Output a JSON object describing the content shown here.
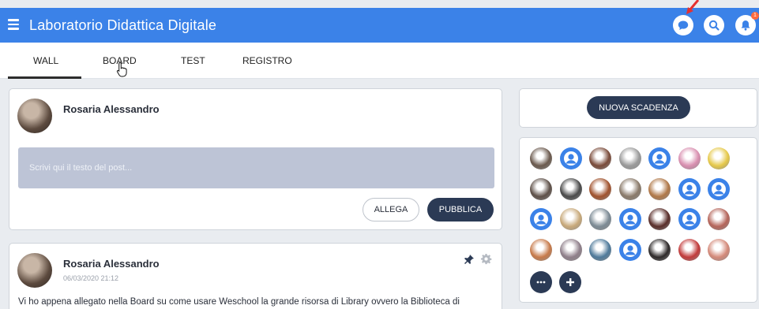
{
  "header": {
    "title": "Laboratorio Didattica Digitale",
    "notification_count": "1",
    "accent_color": "#3b82e8"
  },
  "tabs": [
    {
      "label": "WALL",
      "active": true
    },
    {
      "label": "BOARD",
      "active": false
    },
    {
      "label": "TEST",
      "active": false
    },
    {
      "label": "REGISTRO",
      "active": false
    }
  ],
  "composer": {
    "author": "Rosaria Alessandro",
    "placeholder": "Scrivi qui il testo del post...",
    "attach_label": "ALLEGA",
    "publish_label": "PUBBLICA"
  },
  "post": {
    "author": "Rosaria Alessandro",
    "date": "06/03/2020 21:12",
    "text": "Vi ho appena allegato nella Board su come usare Weschool la grande risorsa di Library ovvero la Biblioteca di"
  },
  "sidebar": {
    "new_deadline_label": "NUOVA SCADENZA",
    "members": [
      {
        "kind": "photo",
        "color": "#6b5a4e"
      },
      {
        "kind": "default",
        "color": "#3b82e8"
      },
      {
        "kind": "photo",
        "color": "#7a4b3a"
      },
      {
        "kind": "photo",
        "color": "#9a9a9a"
      },
      {
        "kind": "default",
        "color": "#3b82e8"
      },
      {
        "kind": "photo",
        "color": "#d98fb0"
      },
      {
        "kind": "photo",
        "color": "#e6c94a"
      },
      {
        "kind": "photo",
        "color": "#5e5048"
      },
      {
        "kind": "photo",
        "color": "#4a4a4a"
      },
      {
        "kind": "photo",
        "color": "#a0522d"
      },
      {
        "kind": "photo",
        "color": "#8a7a6a"
      },
      {
        "kind": "photo",
        "color": "#b07848"
      },
      {
        "kind": "default",
        "color": "#3b82e8"
      },
      {
        "kind": "default",
        "color": "#3b82e8"
      },
      {
        "kind": "default",
        "color": "#3b82e8"
      },
      {
        "kind": "photo",
        "color": "#c8a97a"
      },
      {
        "kind": "photo",
        "color": "#7c8a94"
      },
      {
        "kind": "default",
        "color": "#3b82e8"
      },
      {
        "kind": "photo",
        "color": "#5a2e2a"
      },
      {
        "kind": "default",
        "color": "#3b82e8"
      },
      {
        "kind": "photo",
        "color": "#b5655a"
      },
      {
        "kind": "photo",
        "color": "#c77a4a"
      },
      {
        "kind": "photo",
        "color": "#8f7f8a"
      },
      {
        "kind": "photo",
        "color": "#4f7a9a"
      },
      {
        "kind": "default",
        "color": "#3b82e8"
      },
      {
        "kind": "photo",
        "color": "#2e2a2a"
      },
      {
        "kind": "photo",
        "color": "#c23b3b"
      },
      {
        "kind": "photo",
        "color": "#d48a7a"
      }
    ],
    "more_icon": "ellipsis-icon",
    "add_icon": "plus-icon"
  }
}
